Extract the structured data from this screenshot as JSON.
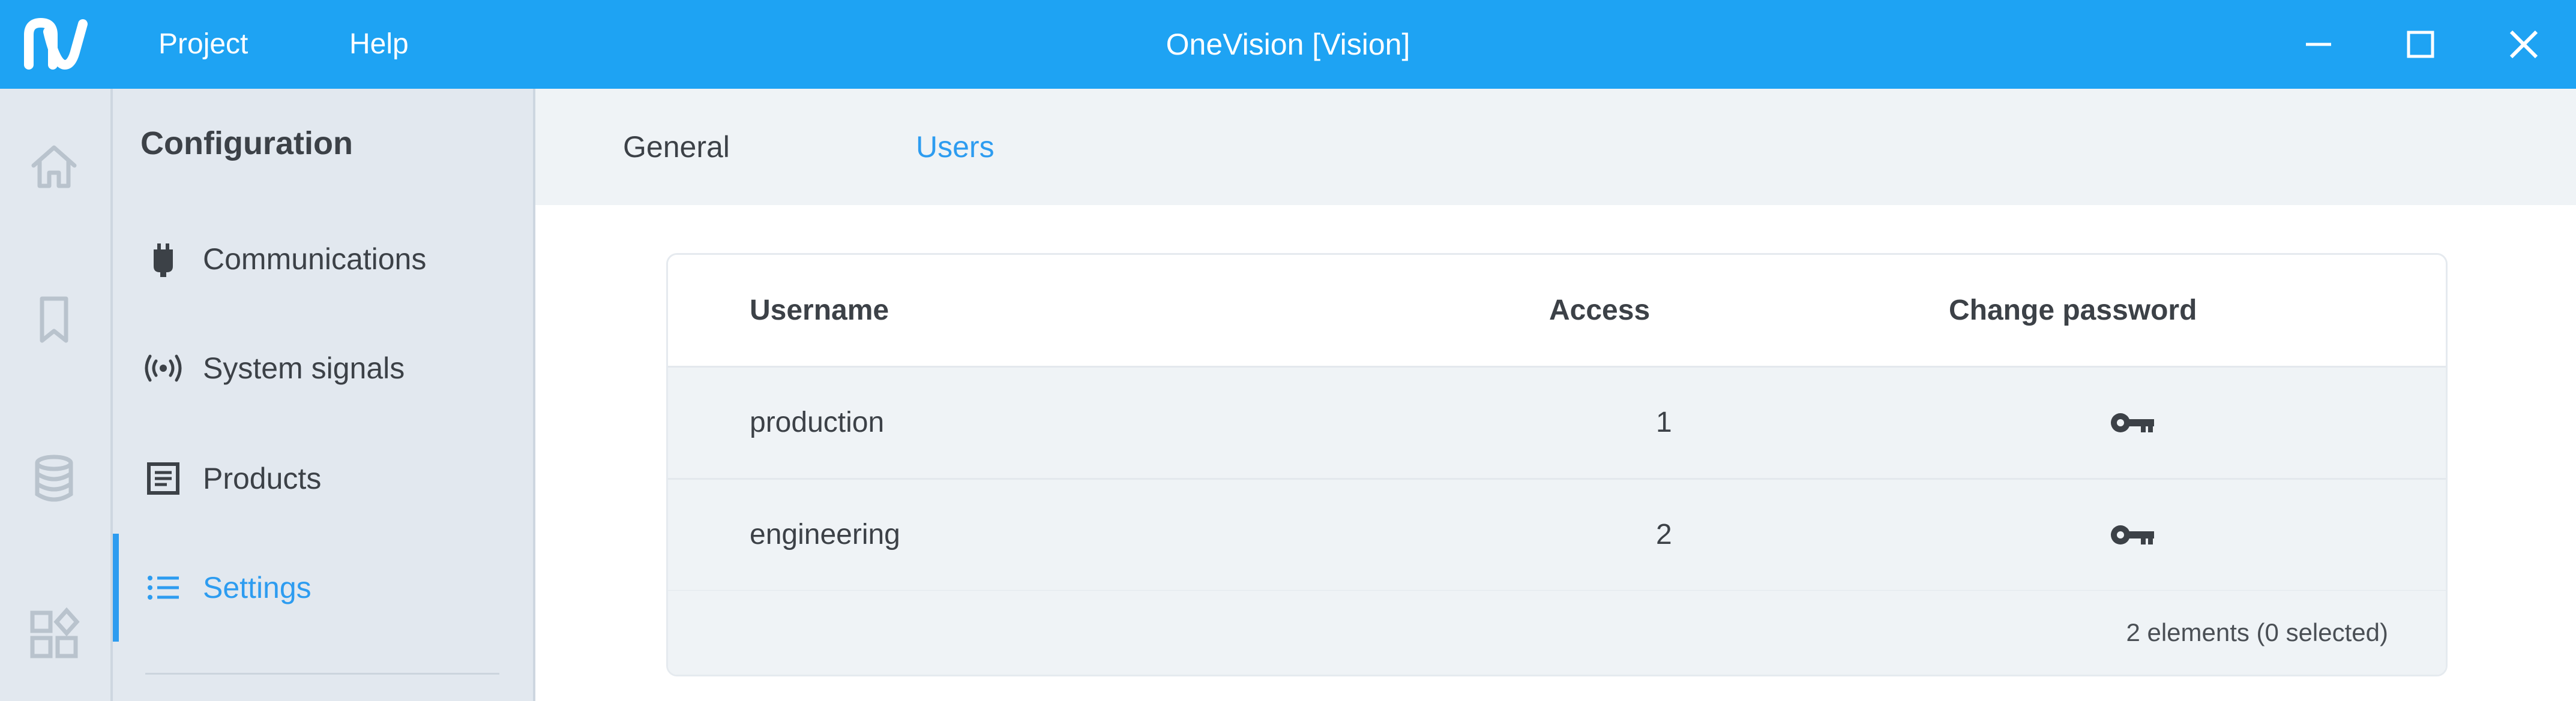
{
  "titlebar": {
    "app_title": "OneVision [Vision]",
    "menu": [
      {
        "label": "Project"
      },
      {
        "label": "Help"
      }
    ]
  },
  "sidebar": {
    "title": "Configuration",
    "items": [
      {
        "label": "Communications",
        "icon": "plug-icon"
      },
      {
        "label": "System signals",
        "icon": "signal-icon"
      },
      {
        "label": "Products",
        "icon": "list-box-icon"
      },
      {
        "label": "Settings",
        "icon": "list-icon",
        "active": true
      }
    ]
  },
  "iconbar": {
    "items": [
      "home-icon",
      "bookmark-icon",
      "database-icon",
      "apps-icon"
    ]
  },
  "tabs": [
    {
      "label": "General"
    },
    {
      "label": "Users",
      "active": true
    }
  ],
  "users_table": {
    "columns": [
      "Username",
      "Access",
      "Change password"
    ],
    "rows": [
      {
        "username": "production",
        "access": "1"
      },
      {
        "username": "engineering",
        "access": "2"
      }
    ],
    "footer": "2 elements (0 selected)"
  },
  "colors": {
    "accent": "#1ea3f3",
    "active": "#2d9cf0",
    "sidebar_bg": "#e2e8ef",
    "row_bg": "#eff3f6"
  }
}
